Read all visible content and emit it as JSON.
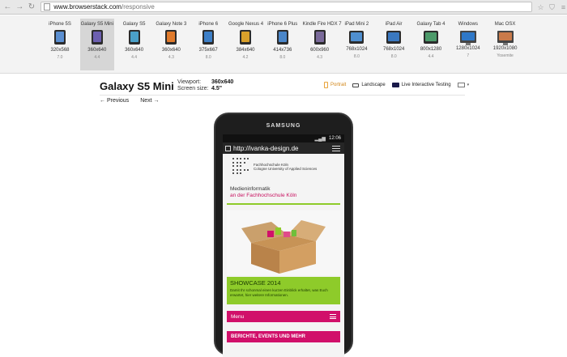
{
  "browser": {
    "url_host": "www.browserstack.com",
    "url_path": "/responsive"
  },
  "devices": [
    {
      "name": "iPhone 5S",
      "resolution": "320x568",
      "os": "7.0",
      "thumb": "phone",
      "screen_color": "#5b8fd1"
    },
    {
      "name": "Galaxy S5 Mini",
      "resolution": "360x640",
      "os": "4.4",
      "thumb": "phone",
      "screen_color": "#6c5fb0",
      "active": true
    },
    {
      "name": "Galaxy S5",
      "resolution": "360x640",
      "os": "4.4",
      "thumb": "phone",
      "screen_color": "#4aa0c8"
    },
    {
      "name": "Galaxy Note 3",
      "resolution": "360x640",
      "os": "4.3",
      "thumb": "phone",
      "screen_color": "#e07a2b"
    },
    {
      "name": "iPhone 6",
      "resolution": "375x667",
      "os": "8.0",
      "thumb": "phone",
      "screen_color": "#3d7fc7"
    },
    {
      "name": "Google Nexus 4",
      "resolution": "384x640",
      "os": "4.2",
      "thumb": "phone",
      "screen_color": "#d9a02b"
    },
    {
      "name": "iPhone 6 Plus",
      "resolution": "414x736",
      "os": "8.0",
      "thumb": "phone",
      "screen_color": "#4a86c9"
    },
    {
      "name": "Kindle Fire HDX 7",
      "resolution": "600x960",
      "os": "4.3",
      "thumb": "phone",
      "screen_color": "#7a6a9a"
    },
    {
      "name": "iPad Mini 2",
      "resolution": "768x1024",
      "os": "8.0",
      "thumb": "tab",
      "screen_color": "#4f8fd0"
    },
    {
      "name": "iPad Air",
      "resolution": "768x1024",
      "os": "8.0",
      "thumb": "tab",
      "screen_color": "#3a78c0"
    },
    {
      "name": "Galaxy Tab 4",
      "resolution": "800x1280",
      "os": "4.4",
      "thumb": "tab",
      "screen_color": "#4c9a6a"
    },
    {
      "name": "Windows",
      "resolution": "1280x1024",
      "os": "7",
      "thumb": "mon",
      "screen_color": "#2f78c8"
    },
    {
      "name": "Mac OSX",
      "resolution": "1920x1080",
      "os": "Yosemite",
      "thumb": "mon",
      "screen_color": "#c97a4a"
    }
  ],
  "header": {
    "device_title": "Galaxy S5 Mini",
    "viewport_label": "Viewport:",
    "viewport_value": "360x640",
    "screen_label": "Screen size:",
    "screen_value": "4.5\""
  },
  "toolbar": {
    "portrait": "Portrait",
    "landscape": "Landscape",
    "live_testing": "Live Interactive Testing"
  },
  "pager": {
    "previous": "← Previous",
    "next": "Next →"
  },
  "phone": {
    "brand": "SAMSUNG",
    "time": "12:06",
    "url": "http://ivanka-design.de"
  },
  "site": {
    "uni_line1": "Fachhochschule Köln",
    "uni_line2": "Cologne University of Applied Sciences",
    "dept_line1": "Medieninformatik",
    "dept_line2": "an der Fachhochschule Köln",
    "showcase_title": "SHOWCASE 2014",
    "showcase_text": "Damit Ihr schonmal einen kurzen Einblick erhaltet, was Euch erwartet, hier weitere Informationen.",
    "menu_label": "Menu",
    "news_label": "BERICHTE, EVENTS UND MEHR"
  },
  "colors": {
    "accent_green": "#8ecb2a",
    "accent_pink": "#d1106a",
    "portrait_accent": "#d18618"
  }
}
